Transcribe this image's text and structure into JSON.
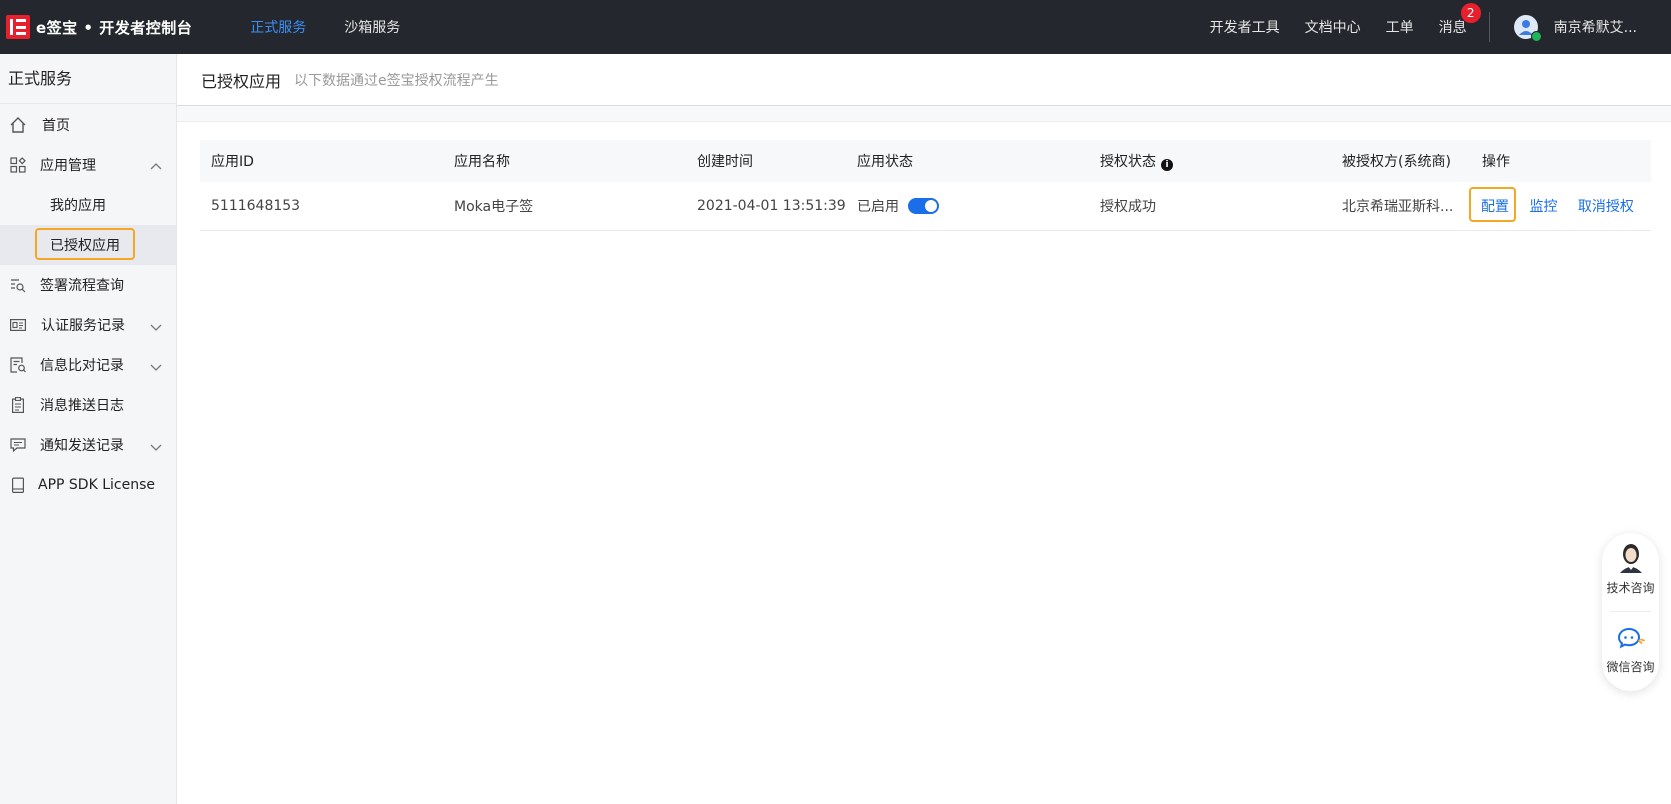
{
  "header": {
    "logo_text": "e签宝 • 开发者控制台",
    "nav": [
      {
        "label": "正式服务",
        "active": true
      },
      {
        "label": "沙箱服务",
        "active": false
      }
    ],
    "right": {
      "dev_tools": "开发者工具",
      "docs": "文档中心",
      "tickets": "工单",
      "messages": "消息",
      "messages_badge": "2",
      "user_name": "南京希默艾..."
    }
  },
  "sidebar": {
    "title": "正式服务",
    "items": [
      {
        "label": "首页",
        "icon": "home-icon"
      },
      {
        "label": "应用管理",
        "icon": "app-grid-icon",
        "expanded": true
      },
      {
        "label": "我的应用"
      },
      {
        "label": "已授权应用",
        "selected": true
      },
      {
        "label": "签署流程查询",
        "icon": "search-list-icon"
      },
      {
        "label": "认证服务记录",
        "icon": "id-card-icon"
      },
      {
        "label": "信息比对记录",
        "icon": "compare-doc-icon"
      },
      {
        "label": "消息推送日志",
        "icon": "clipboard-icon"
      },
      {
        "label": "通知发送记录",
        "icon": "chat-icon"
      },
      {
        "label": "APP SDK License",
        "icon": "book-icon"
      }
    ]
  },
  "page": {
    "title": "已授权应用",
    "subtitle": "以下数据通过e签宝授权流程产生"
  },
  "table": {
    "headers": [
      "应用ID",
      "应用名称",
      "创建时间",
      "应用状态",
      "授权状态",
      "被授权方(系统商)",
      "操作"
    ],
    "info_glyph": "i",
    "rows": [
      {
        "app_id": "5111648153",
        "app_name": "Moka电子签",
        "created": "2021-04-01 13:51:39",
        "status": "已启用",
        "toggle_on": true,
        "auth_status": "授权成功",
        "grantee": "北京希瑞亚斯科...",
        "ops": [
          "配置",
          "监控",
          "取消授权"
        ]
      }
    ]
  },
  "float_widget": {
    "tech": "技术咨询",
    "wechat": "微信咨询"
  },
  "colors": {
    "topbar": "#24272d",
    "accent": "#1a6ee8",
    "highlight": "#f5a623",
    "brand_red": "#e8202d"
  }
}
